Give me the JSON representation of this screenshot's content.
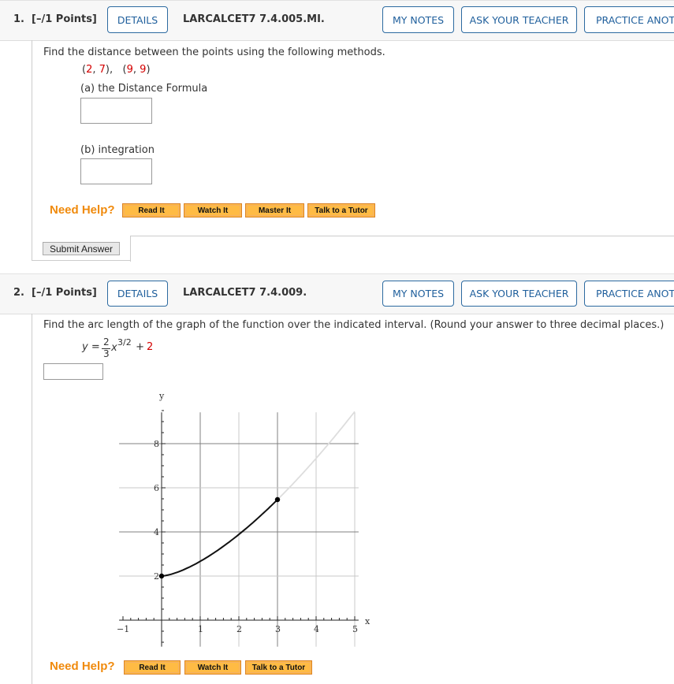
{
  "questions": [
    {
      "number": "1.",
      "points": "[–/1 Points]",
      "details_label": "DETAILS",
      "code": "LARCALCET7 7.4.005.MI.",
      "my_notes_label": "MY NOTES",
      "ask_teacher_label": "ASK YOUR TEACHER",
      "practice_label": "PRACTICE ANOTHER",
      "prompt": "Find the distance between the points using the following methods.",
      "points_list": {
        "p1_open": "(",
        "p1_x": "2",
        "p1_sep": ", ",
        "p1_y": "7",
        "p1_close": "),",
        "p2_open": "(",
        "p2_x": "9",
        "p2_sep": ", ",
        "p2_y": "9",
        "p2_close": ")"
      },
      "part_a": "(a) the Distance Formula",
      "part_b": "(b) integration",
      "need_help": "Need Help?",
      "help_buttons": [
        "Read It",
        "Watch It",
        "Master It",
        "Talk to a Tutor"
      ],
      "submit_label": "Submit Answer"
    },
    {
      "number": "2.",
      "points": "[–/1 Points]",
      "details_label": "DETAILS",
      "code": "LARCALCET7 7.4.009.",
      "my_notes_label": "MY NOTES",
      "ask_teacher_label": "ASK YOUR TEACHER",
      "practice_label": "PRACTICE ANOTHER",
      "prompt": "Find the arc length of the graph of the function over the indicated interval. (Round your answer to three decimal places.)",
      "equation": {
        "lhs": "y = ",
        "num": "2",
        "den": "3",
        "base": "x",
        "exp": "3/2",
        "plus": " + ",
        "const": "2"
      },
      "need_help": "Need Help?",
      "help_buttons": [
        "Read It",
        "Watch It",
        "Talk to a Tutor"
      ]
    }
  ],
  "chart_data": {
    "type": "line",
    "function": "y = (2/3)x^(3/2) + 2",
    "xlabel": "x",
    "ylabel": "y",
    "xlim": [
      -1.1,
      5.1
    ],
    "ylim": [
      -1.2,
      9.6
    ],
    "x_ticks": [
      -1,
      1,
      2,
      3,
      4,
      5
    ],
    "y_ticks": [
      2,
      4,
      6,
      8
    ],
    "grid": true,
    "highlighted_interval": [
      0,
      3
    ],
    "endpoints": [
      {
        "x": 0,
        "y": 2
      },
      {
        "x": 3,
        "y": 5.464
      }
    ],
    "curve_color": "#111111",
    "extension_color": "#dddddd"
  },
  "colors": {
    "accent": "#1f5f9c",
    "help": "#f08a0c",
    "help_button": "#ffbb44",
    "highlight": "#d40000"
  }
}
